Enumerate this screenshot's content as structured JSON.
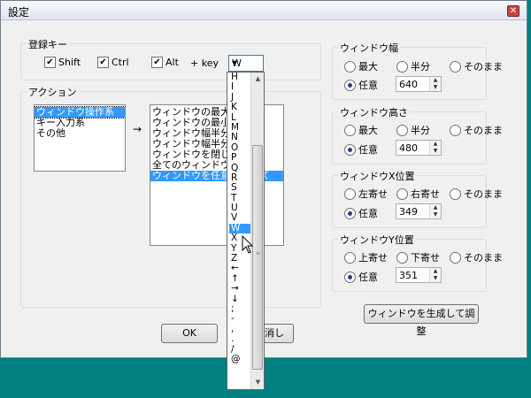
{
  "window": {
    "title": "設定",
    "close_symbol": "✕"
  },
  "hotkey": {
    "legend": "登録キー",
    "shift": {
      "label": "Shift",
      "checked": true
    },
    "ctrl": {
      "label": "Ctrl",
      "checked": true
    },
    "alt": {
      "label": "Alt",
      "checked": true
    },
    "plus_key_label": "+  key",
    "key_value": "W"
  },
  "action": {
    "legend": "アクション",
    "categories": [
      "ウィンドウ操作系",
      "キー入力系",
      "その他"
    ],
    "selected_category": 0,
    "arrow": "→",
    "actions": [
      "ウィンドウの最大化",
      "ウィンドウの最小化",
      "ウィンドウ幅半分で",
      "ウィンドウ幅半分で",
      "ウィンドウを閉じる",
      "全てのウィンドウ最",
      "ウィンドウを任意のサイズ"
    ],
    "selected_action": 6
  },
  "key_dropdown": {
    "items": [
      "H",
      "I",
      "J",
      "K",
      "L",
      "M",
      "N",
      "O",
      "P",
      "Q",
      "R",
      "S",
      "T",
      "U",
      "V",
      "W",
      "X",
      "Y",
      "Z",
      "←",
      "↑",
      "→",
      "↓",
      ";",
      "-",
      ",",
      ".",
      "/",
      "@"
    ],
    "selected": 15
  },
  "width_group": {
    "legend": "ウィンドウ幅",
    "options": [
      "最大",
      "半分",
      "そのまま"
    ],
    "custom_label": "任意",
    "value": "640",
    "selected": "custom"
  },
  "height_group": {
    "legend": "ウィンドウ高さ",
    "options": [
      "最大",
      "半分",
      "そのまま"
    ],
    "custom_label": "任意",
    "value": "480",
    "selected": "custom"
  },
  "x_group": {
    "legend": "ウィンドウX位置",
    "options": [
      "左寄せ",
      "右寄せ",
      "そのまま"
    ],
    "custom_label": "任意",
    "value": "349",
    "selected": "custom"
  },
  "y_group": {
    "legend": "ウィンドウY位置",
    "options": [
      "上寄せ",
      "下寄せ",
      "そのまま"
    ],
    "custom_label": "任意",
    "value": "351",
    "selected": "custom"
  },
  "buttons": {
    "generate": "ウィンドウを生成して調整",
    "ok": "OK",
    "cancel": "取り消し",
    "cancel_visible": "消し"
  }
}
